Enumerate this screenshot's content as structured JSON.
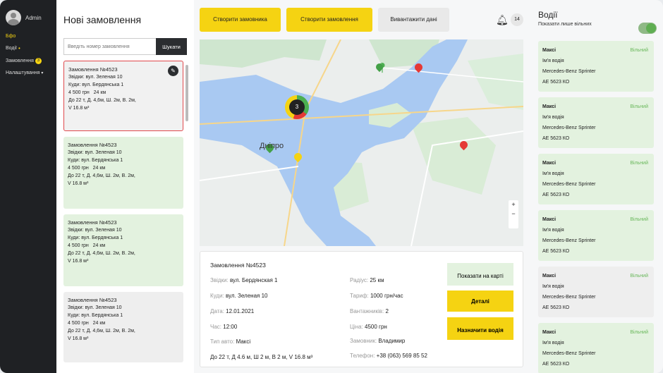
{
  "sidebar": {
    "user": "Admin",
    "items": [
      {
        "label": "Бфо"
      },
      {
        "label": "Водії"
      },
      {
        "label": "Замовлення",
        "badge": "3"
      },
      {
        "label": "Налаштування"
      }
    ]
  },
  "orders": {
    "title": "Нові замовлення",
    "search_placeholder": "Введіть номер замовлення",
    "search_button": "Шукати",
    "cards": [
      {
        "num": "Замовлення №4523",
        "from": "Звідки: вул. Зеленая 10",
        "to": "Куди: вул. Бердянська 1",
        "price": "4 500 грн",
        "dist": "24 км",
        "dims": "До 22 т, Д. 4,6м, Ш. 2м, В. 2м,",
        "vol": "V 16.8 м³",
        "state": "selected"
      },
      {
        "num": "Замовлення №4523",
        "from": "Звідки: вул. Зеленая 10",
        "to": "Куди: вул. Бердянська 1",
        "price": "4 500 грн",
        "dist": "24 км",
        "dims": "До 22 т, Д. 4,6м, Ш. 2м, В. 2м,",
        "vol": "V 16.8 м³",
        "state": "green"
      },
      {
        "num": "Замовлення №4523",
        "from": "Звідки: вул. Зеленая 10",
        "to": "Куди: вул. Бердянська 1",
        "price": "4 500 грн",
        "dist": "24 км",
        "dims": "До 22 т, Д. 4,6м, Ш. 2м, В. 2м,",
        "vol": "V 16.8 м³",
        "state": "green"
      },
      {
        "num": "Замовлення №4523",
        "from": "Звідки: вул. Зеленая 10",
        "to": "Куди: вул. Бердянська 1",
        "price": "4 500 грн",
        "dist": "24 км",
        "dims": "До 22 т, Д. 4,6м, Ш. 2м, В. 2м,",
        "vol": "V 16.8 м³",
        "state": "gray"
      }
    ]
  },
  "toolbar": {
    "create_customer": "Створити замовника",
    "create_order": "Створити замовлення",
    "export": "Вивантажити дані",
    "notifications": "14"
  },
  "map": {
    "city_label": "Дніпро",
    "cluster_count": "3"
  },
  "details": {
    "title": "Замовлення №4523",
    "from_label": "Звідки:",
    "from": "вул. Бердянская 1",
    "to_label": "Куди:",
    "to": "вул. Зеленая 10",
    "date_label": "Дата:",
    "date": "12.01.2021",
    "time_label": "Час:",
    "time": "12:00",
    "type_label": "Тип авто:",
    "type": "Максі",
    "dims": "До 22 т, Д 4.6 м, Ш 2 м, В 2 м, V 16.8 м³",
    "radius_label": "Радіус:",
    "radius": "25 км",
    "tariff_label": "Тариф:",
    "tariff": "1000 грн/час",
    "loaders_label": "Вантажників:",
    "loaders": "2",
    "price_label": "Ціна:",
    "price": "4500 грн",
    "customer_label": "Замовник:",
    "customer": "Владимир",
    "phone_label": "Телефон:",
    "phone": "+38 (063) 569 85 52",
    "btn_show": "Показати на карті",
    "btn_details": "Деталі",
    "btn_assign": "Назначити водія"
  },
  "drivers": {
    "title": "Водії",
    "subtitle": "Показати лише вільних",
    "cards": [
      {
        "type": "Максі",
        "status": "Вільний",
        "name": "Ім'я водія",
        "car": "Mercedes-Benz Sprinter",
        "plate": "АЕ 5623 КО",
        "state": "green"
      },
      {
        "type": "Максі",
        "status": "Вільний",
        "name": "Ім'я водія",
        "car": "Mercedes-Benz Sprinter",
        "plate": "АЕ 5623 КО",
        "state": "green"
      },
      {
        "type": "Максі",
        "status": "Вільний",
        "name": "Ім'я водія",
        "car": "Mercedes-Benz Sprinter",
        "plate": "АЕ 5623 КО",
        "state": "green"
      },
      {
        "type": "Максі",
        "status": "Вільний",
        "name": "Ім'я водія",
        "car": "Mercedes-Benz Sprinter",
        "plate": "АЕ 5623 КО",
        "state": "green"
      },
      {
        "type": "Максі",
        "status": "Вільний",
        "name": "Ім'я водія",
        "car": "Mercedes-Benz Sprinter",
        "plate": "АЕ 5623 КО",
        "state": "gray"
      },
      {
        "type": "Максі",
        "status": "Вільний",
        "name": "Ім'я водія",
        "car": "Mercedes-Benz Sprinter",
        "plate": "АЕ 5623 КО",
        "state": "green"
      }
    ]
  },
  "colors": {
    "accent": "#f5d312",
    "free": "#e3f2df",
    "busy": "#eeeeee",
    "selected_border": "#e0484c"
  }
}
